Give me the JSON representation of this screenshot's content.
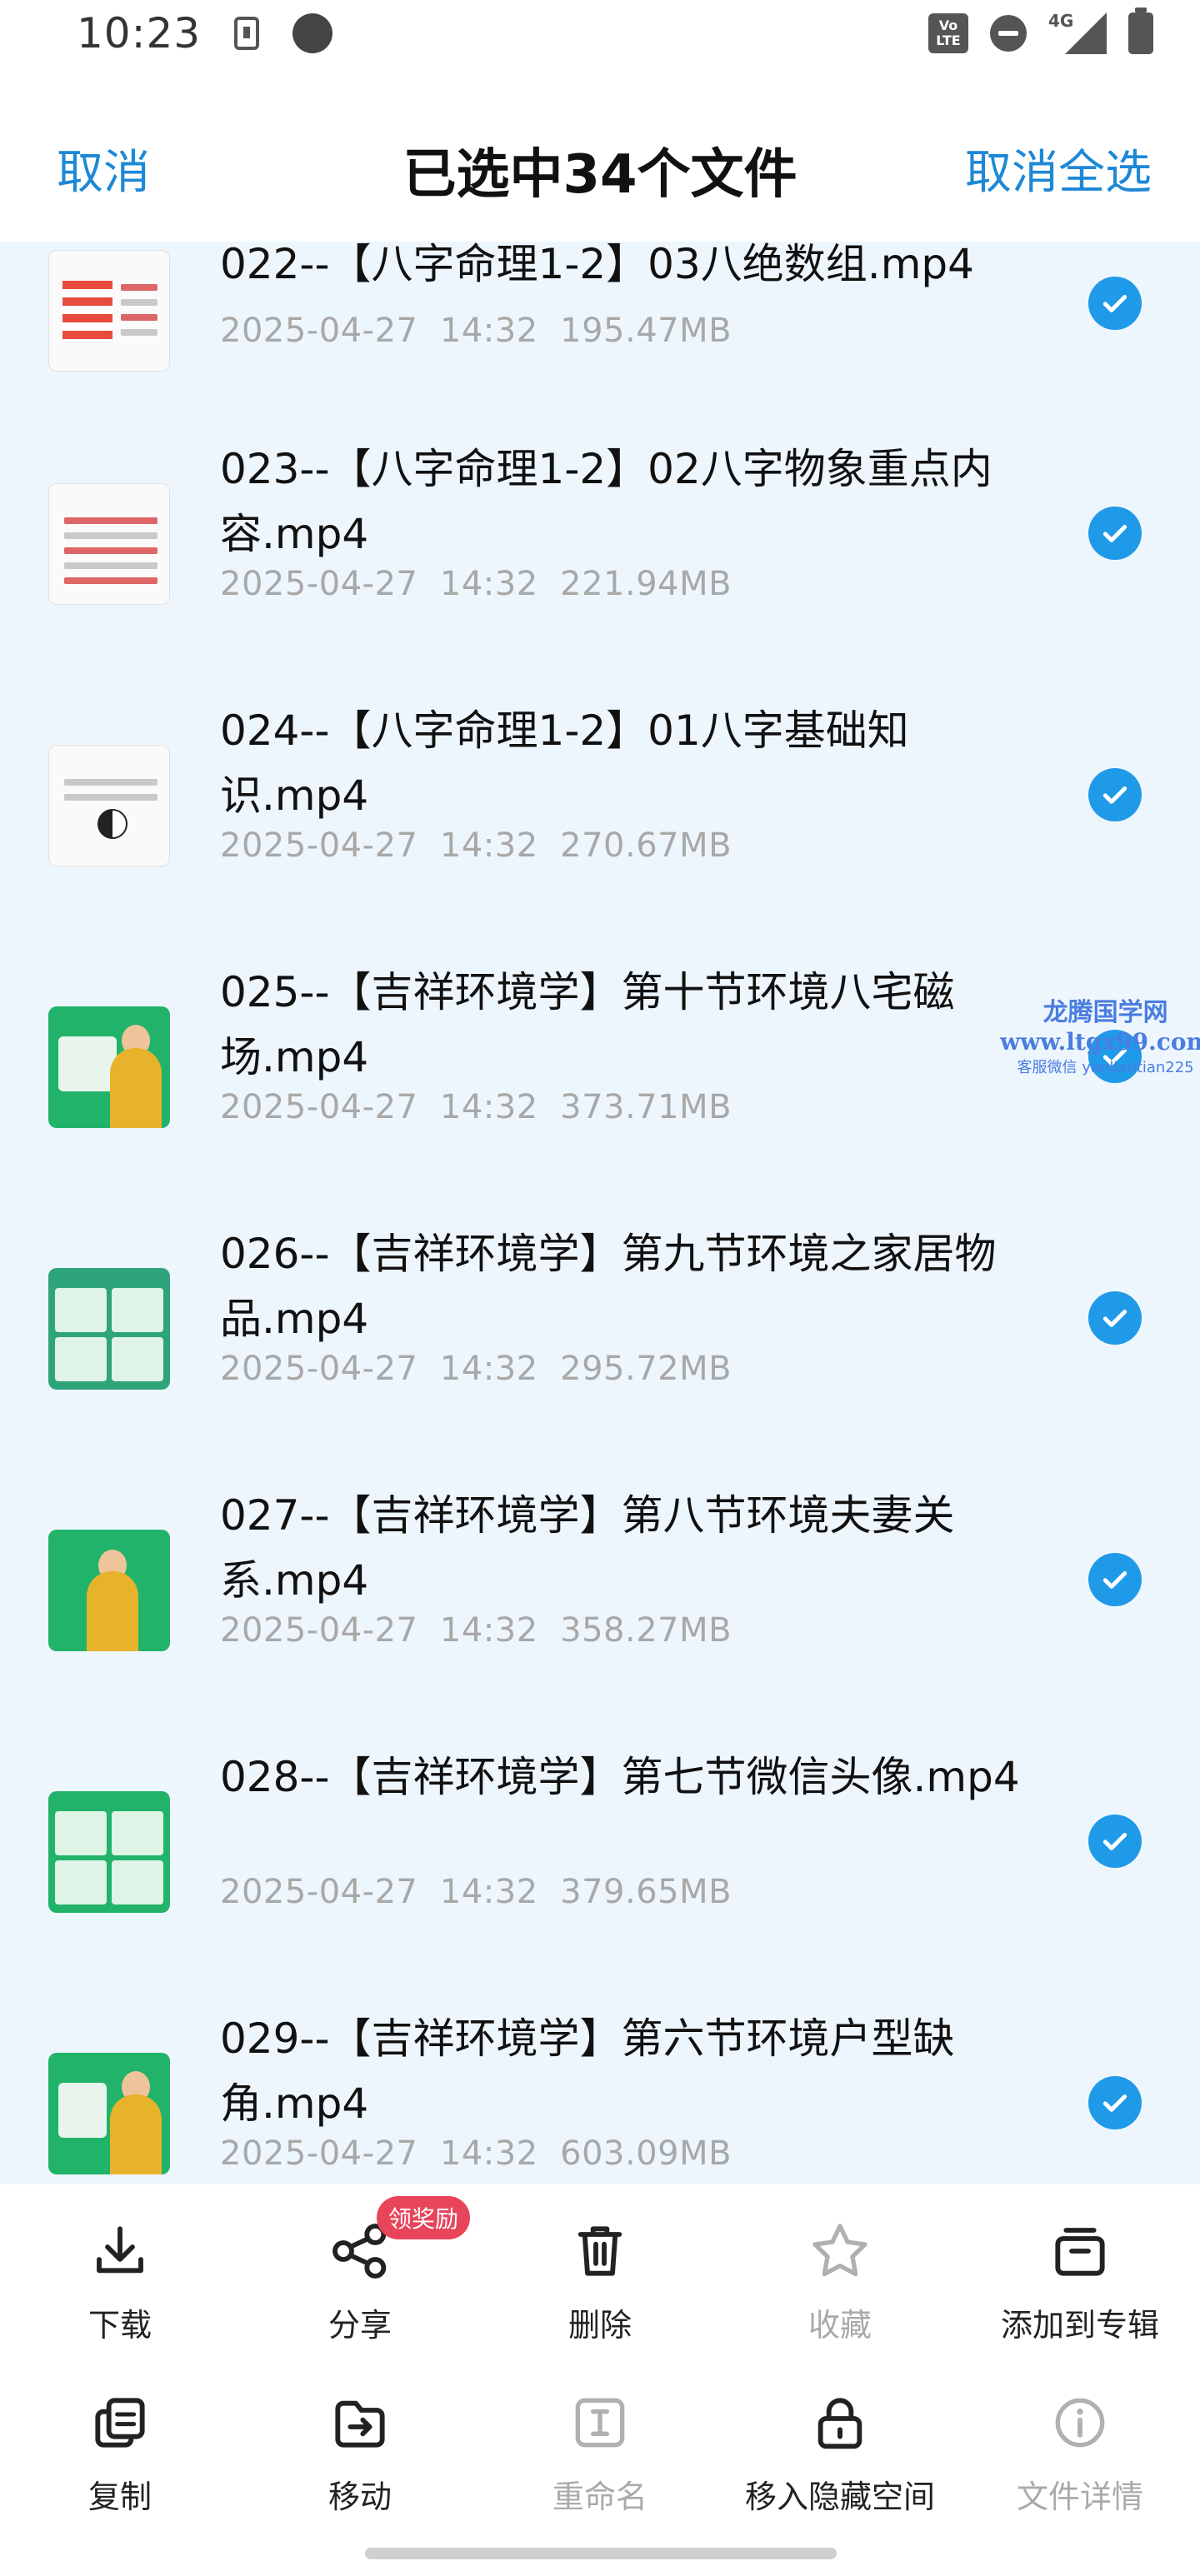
{
  "status_bar": {
    "time": "10:23",
    "network": "4G",
    "volte_label": "Vo LTE"
  },
  "header": {
    "cancel_label": "取消",
    "title": "已选中34个文件",
    "cancel_all_label": "取消全选"
  },
  "files": [
    {
      "name": "022--【八字命理1-2】03八绝数组.mp4",
      "date": "2025-04-27",
      "time": "14:32",
      "size": "195.47MB",
      "checked": true
    },
    {
      "name": "023--【八字命理1-2】02八字物象重点内容.mp4",
      "date": "2025-04-27",
      "time": "14:32",
      "size": "221.94MB",
      "checked": true
    },
    {
      "name": "024--【八字命理1-2】01八字基础知识.mp4",
      "date": "2025-04-27",
      "time": "14:32",
      "size": "270.67MB",
      "checked": true
    },
    {
      "name": "025--【吉祥环境学】第十节环境八宅磁场.mp4",
      "date": "2025-04-27",
      "time": "14:32",
      "size": "373.71MB",
      "checked": true
    },
    {
      "name": "026--【吉祥环境学】第九节环境之家居物品.mp4",
      "date": "2025-04-27",
      "time": "14:32",
      "size": "295.72MB",
      "checked": true
    },
    {
      "name": "027--【吉祥环境学】第八节环境夫妻关系.mp4",
      "date": "2025-04-27",
      "time": "14:32",
      "size": "358.27MB",
      "checked": true
    },
    {
      "name": "028--【吉祥环境学】第七节微信头像.mp4",
      "date": "2025-04-27",
      "time": "14:32",
      "size": "379.65MB",
      "checked": true
    },
    {
      "name": "029--【吉祥环境学】第六节环境户型缺角.mp4",
      "date": "2025-04-27",
      "time": "14:32",
      "size": "603.09MB",
      "checked": true
    }
  ],
  "watermark": {
    "line1": "龙腾国学网",
    "line2": "www.ltgx99.com",
    "line3": "客服微信 yanliantian225"
  },
  "actions": {
    "download": "下载",
    "share": "分享",
    "share_badge": "领奖励",
    "delete": "删除",
    "favorite": "收藏",
    "add_to_album": "添加到专辑",
    "copy": "复制",
    "move": "移动",
    "rename": "重命名",
    "move_to_hidden": "移入隐藏空间",
    "file_details": "文件详情"
  },
  "colors": {
    "accent": "#1d88d6",
    "check": "#1f9ae8",
    "list_bg": "#eef6fd",
    "badge": "#e8445a"
  }
}
